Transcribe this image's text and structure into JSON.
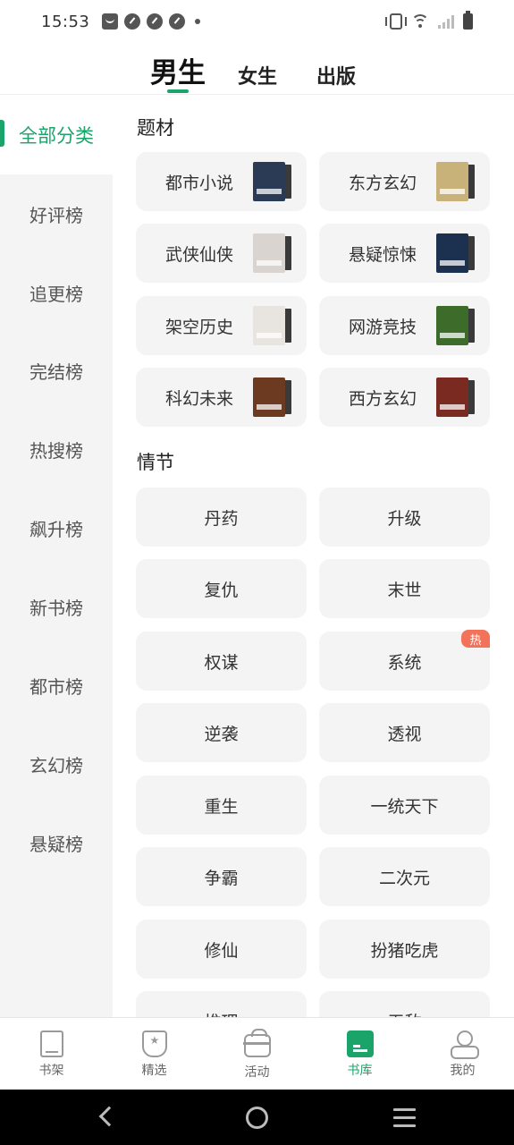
{
  "status_bar": {
    "time": "15:53"
  },
  "top_tabs": [
    "男生",
    "女生",
    "出版"
  ],
  "sidebar": {
    "items": [
      {
        "label": "全部分类"
      },
      {
        "label": "好评榜"
      },
      {
        "label": "追更榜"
      },
      {
        "label": "完结榜"
      },
      {
        "label": "热搜榜"
      },
      {
        "label": "飙升榜"
      },
      {
        "label": "新书榜"
      },
      {
        "label": "都市榜"
      },
      {
        "label": "玄幻榜"
      },
      {
        "label": "悬疑榜"
      }
    ]
  },
  "sections": {
    "genre": {
      "title": "题材",
      "items": [
        {
          "label": "都市小说",
          "cover_color": "#2b3a55"
        },
        {
          "label": "东方玄幻",
          "cover_color": "#c9b27a"
        },
        {
          "label": "武侠仙侠",
          "cover_color": "#d9d4cf"
        },
        {
          "label": "悬疑惊悚",
          "cover_color": "#1c3050"
        },
        {
          "label": "架空历史",
          "cover_color": "#e8e4e0"
        },
        {
          "label": "网游竞技",
          "cover_color": "#3d6b2a"
        },
        {
          "label": "科幻未来",
          "cover_color": "#6b3a20"
        },
        {
          "label": "西方玄幻",
          "cover_color": "#7a2a20"
        }
      ]
    },
    "plot": {
      "title": "情节",
      "hot_badge": "热",
      "items": [
        "丹药",
        "升级",
        "复仇",
        "末世",
        "权谋",
        "系统",
        "逆袭",
        "透视",
        "重生",
        "一统天下",
        "争霸",
        "二次元",
        "修仙",
        "扮猪吃虎",
        "推理",
        "无敌"
      ]
    }
  },
  "bottom_nav": {
    "items": [
      {
        "label": "书架",
        "icon": "bookshelf-icon"
      },
      {
        "label": "精选",
        "icon": "featured-badge-icon"
      },
      {
        "label": "活动",
        "icon": "gift-icon"
      },
      {
        "label": "书库",
        "icon": "library-icon"
      },
      {
        "label": "我的",
        "icon": "profile-icon"
      }
    ],
    "active_index": 3
  },
  "colors": {
    "accent": "#1aa46a",
    "hot_badge": "#f2735a",
    "sidebar_bg": "#f4f4f4",
    "card_bg": "#f4f4f4"
  }
}
